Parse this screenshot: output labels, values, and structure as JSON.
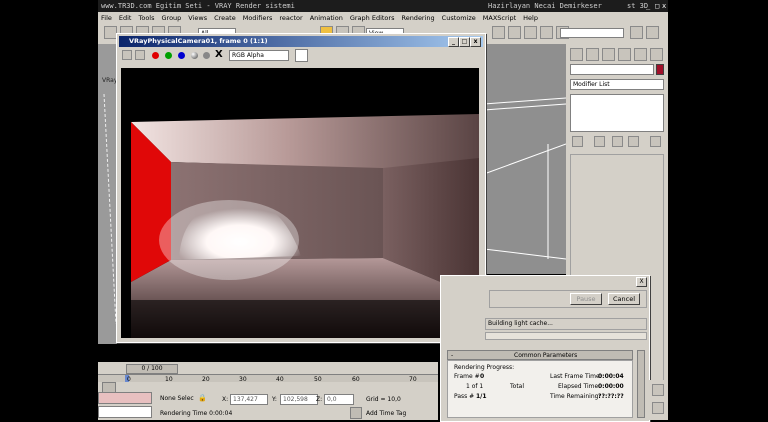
{
  "title_bar": {
    "left": "www.TR3D.com Egitim Seti -  VRAY Render sistemi",
    "right": "Hazirlayan Necai Demirkeser",
    "app_suffix": "st 3D"
  },
  "menu": [
    "File",
    "Edit",
    "Tools",
    "Group",
    "Views",
    "Create",
    "Modifiers",
    "reactor",
    "Animation",
    "Graph Editors",
    "Rendering",
    "Customize",
    "MAXScript",
    "Help"
  ],
  "toolbar": {
    "selection_filter": "All",
    "view_combo": "View"
  },
  "viewport": {
    "label": "VRay"
  },
  "frame_window": {
    "title": "VRayPhysicalCamera01, frame 0 (1:1)",
    "channel": "RGB Alpha",
    "close_symbol": "X",
    "colors": {
      "red": "#e00000",
      "green": "#00a000",
      "blue": "#0000d0"
    }
  },
  "command_panel": {
    "modifier_list": "Modifier List"
  },
  "timeline": {
    "frame_counter": "0 / 100",
    "ticks": [
      "0",
      "10",
      "20",
      "30",
      "40",
      "50",
      "60",
      "70"
    ]
  },
  "status": {
    "selection": "None Select",
    "x_label": "X:",
    "x_value": "137,427",
    "y_label": "Y:",
    "y_value": "102,598",
    "z_label": "Z:",
    "z_value": "0,0",
    "grid": "Grid = 10,0",
    "render_time": "Rendering Time  0:00:04",
    "add_time_tag": "Add Time Tag"
  },
  "render_dialog": {
    "close_symbol": "X",
    "pause": "Pause",
    "cancel": "Cancel",
    "status_text": "Building light cache...",
    "rollout_title": "Common Parameters",
    "rollout_sign": "-",
    "progress_label": "Rendering Progress:",
    "frame_label": "Frame #",
    "frame_value": "0",
    "of_label": "1 of 1",
    "total_label": "Total",
    "pass_label": "Pass #",
    "pass_value": "1/1",
    "last_frame_label": "Last Frame Time:",
    "last_frame_value": "0:00:04",
    "elapsed_label": "Elapsed Time:",
    "elapsed_value": "0:00:00",
    "remaining_label": "Time Remaining:",
    "remaining_value": "??:??:??"
  }
}
